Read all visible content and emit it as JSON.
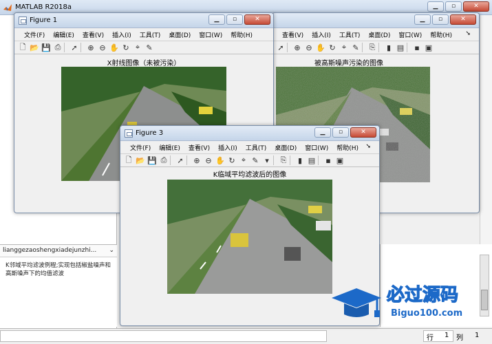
{
  "main_window": {
    "title": "MATLAB R2018a"
  },
  "panel": {
    "filename": "lianggezaoshengxiadejunzhi...",
    "description": "K邻域平均滤波例程;实现包括椒盐噪声和高斯噪声下的均值滤波"
  },
  "statusbar": {
    "row_label": "行",
    "row_value": "1",
    "col_label": "列",
    "col_value": "1"
  },
  "menus": [
    "文件(F)",
    "编辑(E)",
    "查看(V)",
    "插入(I)",
    "工具(T)",
    "桌面(D)",
    "窗口(W)",
    "帮助(H)"
  ],
  "figures": [
    {
      "title": "Figure 1",
      "axes_title": "X射线图像（未被污染）"
    },
    {
      "title": "",
      "axes_title": "被高斯噪声污染的图像"
    },
    {
      "title": "Figure 3",
      "axes_title": "K临域平均滤波后的图像"
    }
  ],
  "watermark": {
    "cn": "必过源码",
    "en": "Biguo100.com"
  },
  "icons": [
    "matlab-logo-icon",
    "new-figure-icon",
    "open-icon",
    "save-icon",
    "print-icon",
    "pointer-icon",
    "zoom-in-icon",
    "zoom-out-icon",
    "pan-icon",
    "rotate-icon",
    "data-cursor-icon",
    "brush-icon",
    "link-icon",
    "colorbar-icon",
    "legend-icon",
    "hide-plot-tools-icon",
    "show-plot-tools-icon"
  ]
}
